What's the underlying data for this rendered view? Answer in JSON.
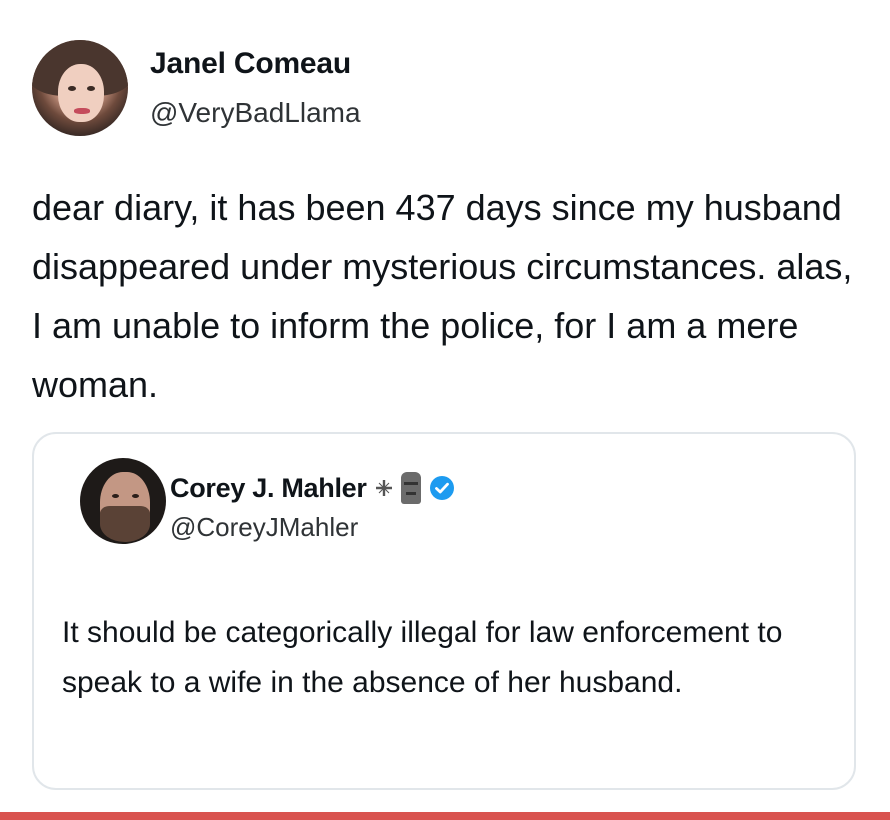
{
  "tweet": {
    "author_name": "Janel Comeau",
    "author_handle": "@VeryBadLlama",
    "text": "dear diary, it has been 437 days since my husband disappeared under mysterious circumstances. alas, I am unable to inform the police, for I am a mere woman."
  },
  "quoted_tweet": {
    "author_name": "Corey J. Mahler",
    "author_handle": "@CoreyJMahler",
    "badges": [
      "cross-icon",
      "moai-icon",
      "verified-badge-icon"
    ],
    "verified_color": "#1d9bf0",
    "text": "It should be categorically illegal for law enforcement to speak to a wife in the absence of her husband."
  },
  "colors": {
    "accent_bar": "#d9534f",
    "card_border": "#e1e6ea"
  }
}
